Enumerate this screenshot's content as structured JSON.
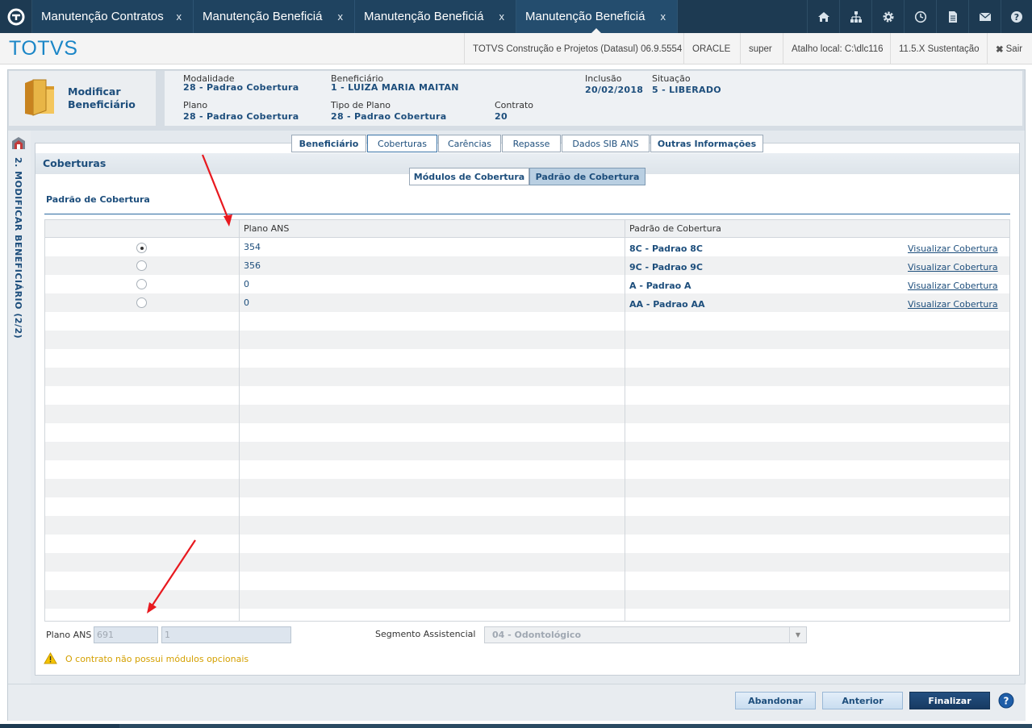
{
  "tabs": [
    {
      "label": "Manutenção Contratos",
      "close": "x"
    },
    {
      "label": "Manutenção Beneficiá",
      "close": "x"
    },
    {
      "label": "Manutenção Beneficiá",
      "close": "x"
    },
    {
      "label": "Manutenção Beneficiá",
      "close": "x"
    }
  ],
  "toolbar_icons": [
    "home-icon",
    "sitemap-icon",
    "gear-icon",
    "clock-icon",
    "document-icon",
    "mail-icon",
    "help-icon"
  ],
  "brand": "TOTVS",
  "header_info": {
    "product": "TOTVS Construção e Projetos (Datasul) 06.9.5554",
    "db": "ORACLE",
    "user": "super",
    "shortcut": "Atalho local: C:\\dlc116",
    "version": "11.5.X Sustentação",
    "exit": "Sair"
  },
  "page_title": "Modificar Beneficiário",
  "fields": {
    "modalidade_label": "Modalidade",
    "modalidade_value": "28 - Padrao Cobertura",
    "beneficiario_label": "Beneficiário",
    "beneficiario_value": "1 - LUIZA MARIA MAITAN",
    "inclusao_label": "Inclusão",
    "inclusao_value": "20/02/2018",
    "situacao_label": "Situação",
    "situacao_value": "5 - LIBERADO",
    "plano_label": "Plano",
    "plano_value": "28 - Padrao Cobertura",
    "tipo_plano_label": "Tipo de Plano",
    "tipo_plano_value": "28 - Padrao Cobertura",
    "contrato_label": "Contrato",
    "contrato_value": "20"
  },
  "sidebar_step": "2. MODIFICAR BENEFICIÁRIO (2/2)",
  "main_tabs": [
    {
      "label": "Beneficiário",
      "selected": false
    },
    {
      "label": "Coberturas",
      "selected": true
    },
    {
      "label": "Carências",
      "selected": false
    },
    {
      "label": "Repasse",
      "selected": false
    },
    {
      "label": "Dados SIB ANS",
      "selected": false
    },
    {
      "label": "Outras Informações",
      "selected": false
    }
  ],
  "section_title": "Coberturas",
  "sub_tabs": [
    {
      "label": "Módulos de Cobertura",
      "selected": false
    },
    {
      "label": "Padrão de Cobertura",
      "selected": true
    }
  ],
  "subsection_title": "Padrão de Cobertura",
  "grid": {
    "columns": [
      "",
      "Plano ANS",
      "Padrão de Cobertura"
    ],
    "rows": [
      {
        "selected": true,
        "plano_ans": "354",
        "padrao": "8C - Padrao 8C",
        "link": "Visualizar Cobertura"
      },
      {
        "selected": false,
        "plano_ans": "356",
        "padrao": "9C - Padrao 9C",
        "link": "Visualizar Cobertura"
      },
      {
        "selected": false,
        "plano_ans": "0",
        "padrao": "A - Padrao A",
        "link": "Visualizar Cobertura"
      },
      {
        "selected": false,
        "plano_ans": "0",
        "padrao": "AA - Padrao AA",
        "link": "Visualizar Cobertura"
      }
    ]
  },
  "form": {
    "plano_ans_label": "Plano ANS",
    "plano_ans_value1": "691",
    "plano_ans_value2": "1",
    "segmento_label": "Segmento Assistencial",
    "segmento_value": "04 - Odontológico"
  },
  "warning": "O contrato não possui módulos opcionais",
  "buttons": {
    "abandonar": "Abandonar",
    "anterior": "Anterior",
    "finalizar": "Finalizar"
  },
  "colors": {
    "topbar": "#1d3a52",
    "brand": "#1b86c7",
    "accent_text": "#1d4e7c",
    "warning": "#d4a000",
    "annotation_arrow": "#e8191f"
  }
}
